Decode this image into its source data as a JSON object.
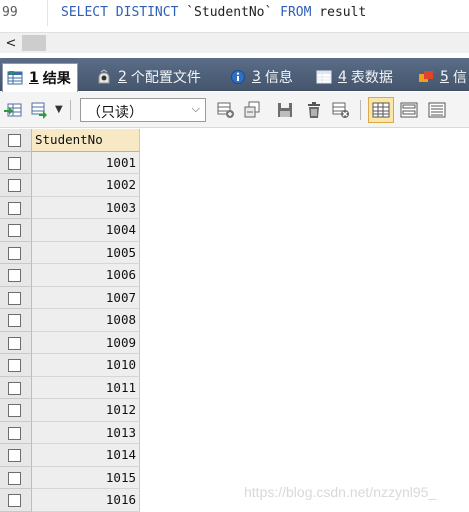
{
  "editor": {
    "line_number": "99",
    "sql": {
      "kw1": "SELECT DISTINCT",
      "ident": "`StudentNo`",
      "kw2": "FROM",
      "table": "result"
    }
  },
  "scrollbar": {
    "left_arrow": "<"
  },
  "tabs": [
    {
      "num": "1",
      "label": "结果",
      "icon": "table-result-icon",
      "active": true
    },
    {
      "num": "2",
      "label": "个配置文件",
      "icon": "profile-icon",
      "active": false
    },
    {
      "num": "3",
      "label": "信息",
      "icon": "info-icon",
      "active": false
    },
    {
      "num": "4",
      "label": "表数据",
      "icon": "table-data-icon",
      "active": false
    },
    {
      "num": "5",
      "label": "信",
      "icon": "info-history-icon",
      "active": false
    }
  ],
  "toolbar": {
    "mode_value": "（只读）",
    "icons": [
      "export-icon",
      "import-icon",
      "mode-dropdown",
      "add-row-icon",
      "copy-row-icon",
      "save-icon",
      "delete-icon",
      "discard-icon",
      "grid-view-icon",
      "form-view-icon",
      "text-view-icon"
    ]
  },
  "grid": {
    "column_header": "StudentNo",
    "rows": [
      "1001",
      "1002",
      "1003",
      "1004",
      "1005",
      "1006",
      "1007",
      "1008",
      "1009",
      "1010",
      "1011",
      "1012",
      "1013",
      "1014",
      "1015",
      "1016"
    ]
  },
  "watermark": "https://blog.csdn.net/nzzynl95_",
  "colors": {
    "keyword": "#2f5fb8",
    "tabbar": "#4f6079",
    "header_cell": "#f6e9c4",
    "toggle_on": "#fbe6a8"
  }
}
